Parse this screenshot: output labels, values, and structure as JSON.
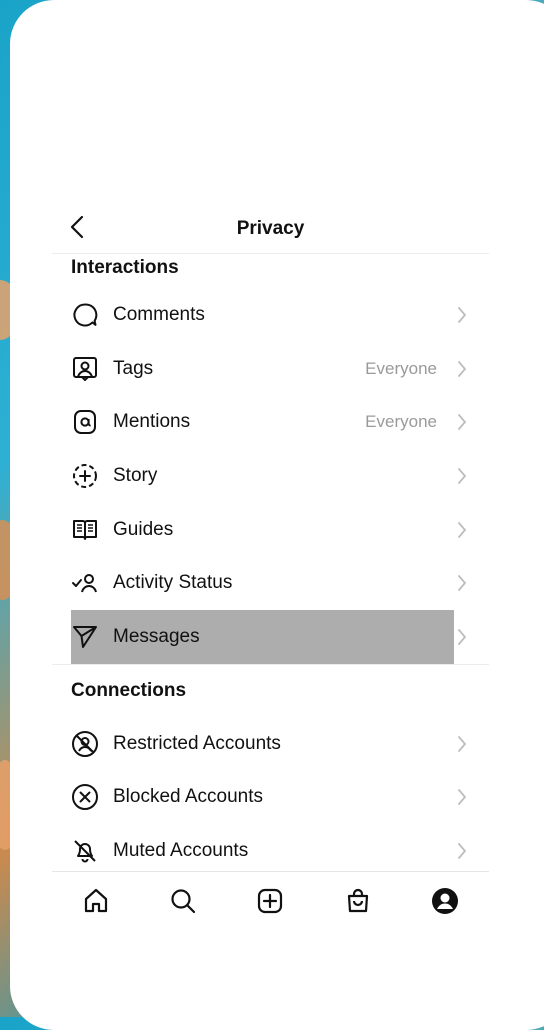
{
  "header": {
    "title": "Privacy"
  },
  "interactions": {
    "title": "Interactions",
    "items": [
      {
        "label": "Comments",
        "value": ""
      },
      {
        "label": "Tags",
        "value": "Everyone"
      },
      {
        "label": "Mentions",
        "value": "Everyone"
      },
      {
        "label": "Story",
        "value": ""
      },
      {
        "label": "Guides",
        "value": ""
      },
      {
        "label": "Activity Status",
        "value": ""
      },
      {
        "label": "Messages",
        "value": ""
      }
    ]
  },
  "connections": {
    "title": "Connections",
    "items": [
      {
        "label": "Restricted Accounts"
      },
      {
        "label": "Blocked Accounts"
      },
      {
        "label": "Muted Accounts"
      }
    ]
  },
  "nav": [
    "home-icon",
    "search-icon",
    "new-post-icon",
    "shop-icon",
    "profile-icon"
  ],
  "colors": {
    "highlight": "#adadad",
    "secondary_text": "#9a9a9a"
  }
}
